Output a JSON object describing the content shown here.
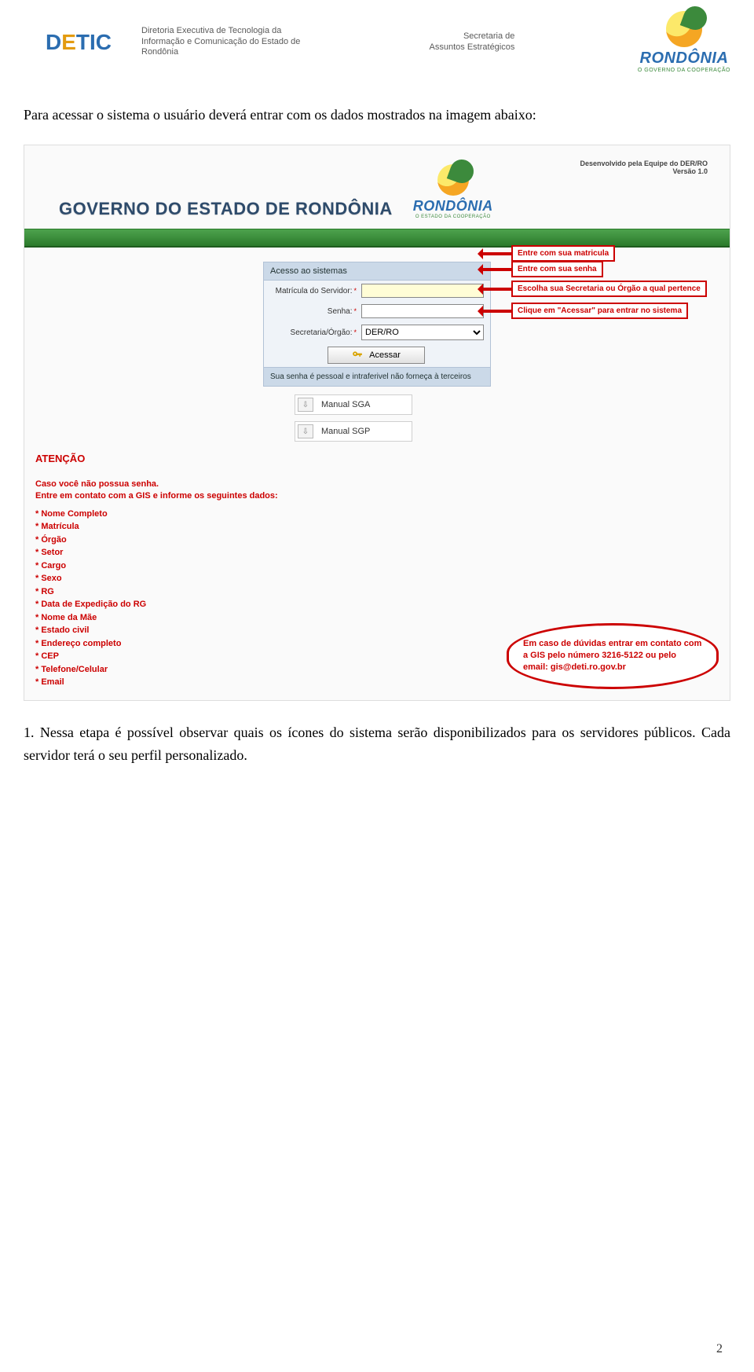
{
  "doc_header": {
    "detic_logo_text": "DETIC",
    "detic_sub": "Diretoria Executiva de Tecnologia da Informação e Comunicação do Estado de Rondônia",
    "sae_line1": "Secretaria de",
    "sae_line2": "Assuntos Estratégicos",
    "rondonia": "RONDÔNIA",
    "rondonia_tag": "O GOVERNO DA COOPERAÇÃO"
  },
  "intro": "Para acessar o sistema o usuário deverá entrar com os dados mostrados na imagem abaixo:",
  "app": {
    "dev_line1": "Desenvolvido pela Equipe do DER/RO",
    "dev_line2": "Versão 1.0",
    "gov_title": "GOVERNO DO ESTADO DE  RONDÔNIA",
    "rondonia": "RONDÔNIA",
    "rondonia_sub": "O ESTADO DA COOPERAÇÃO",
    "panel_title": "Acesso ao sistemas",
    "label_matricula": "Matrícula do Servidor:",
    "label_senha": "Senha:",
    "label_secretaria": "Secretaria/Órgão:",
    "select_value": "DER/RO",
    "btn_acessar": "Acessar",
    "panel_foot": "Sua senha é pessoal e intraferivel não forneça à terceiros",
    "manual1": "Manual SGA",
    "manual2": "Manual SGP",
    "tip1": "Entre com sua matricula",
    "tip2": "Entre com sua senha",
    "tip3": "Escolha sua Secretaria ou Órgão a qual pertence",
    "tip4": "Clique em \"Acessar\" para entrar no sistema",
    "aten_title": "ATENÇÃO",
    "aten_sub1": "Caso você não possua senha.",
    "aten_sub2": "Entre em contato com a GIS e informe os seguintes dados:",
    "aten_items": [
      "* Nome Completo",
      "* Matrícula",
      "* Órgão",
      "* Setor",
      "* Cargo",
      "* Sexo",
      "* RG",
      "* Data de Expedição do RG",
      "* Nome da Mãe",
      "* Estado civil",
      "* Endereço completo",
      "* CEP",
      "* Telefone/Celular",
      "* Email"
    ],
    "contact": "Em caso de dúvidas entrar em contato com a GIS pelo número 3216-5122 ou pelo email: gis@deti.ro.gov.br"
  },
  "note": "1. Nessa etapa é possível observar quais os ícones do sistema serão disponibilizados para os servidores públicos. Cada servidor terá o seu perfil personalizado.",
  "page_number": "2"
}
